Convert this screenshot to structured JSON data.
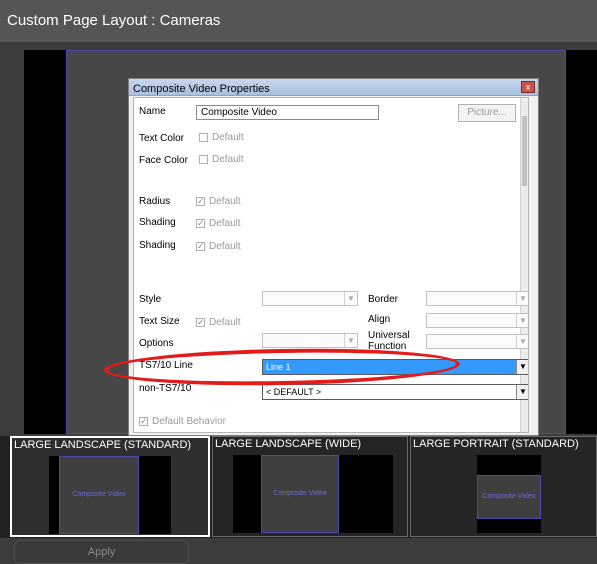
{
  "window": {
    "title": "Custom Page Layout : Cameras"
  },
  "dialog": {
    "title": "Composite Video Properties",
    "close_glyph": "x",
    "name_label": "Name",
    "name_value": "Composite Video",
    "picture_button": "Picture...",
    "text_color_label": "Text Color",
    "face_color_label": "Face Color",
    "radius_label": "Radius",
    "shading_label": "Shading",
    "shading2_label": "Shading",
    "default_label": "Default",
    "style_label": "Style",
    "border_label": "Border",
    "text_size_label": "Text Size",
    "align_label": "Align",
    "options_label": "Options",
    "universal_function_label": "Universal Function",
    "ts710_label": "TS7/10 Line",
    "ts710_value": "Line 1",
    "non_ts710_label": "non-TS7/10",
    "non_ts710_value": "< DEFAULT >",
    "default_behavior_label": "Default Behavior",
    "checkmark": "✓",
    "dropdown_arrow": "▼"
  },
  "layout_tabs": [
    {
      "label": "LARGE LANDSCAPE (STANDARD)",
      "preview_text": "Composite Video"
    },
    {
      "label": "LARGE LANDSCAPE (WIDE)",
      "preview_text": "Composite Video"
    },
    {
      "label": "LARGE PORTRAIT (STANDARD)",
      "preview_text": "Composite Video"
    }
  ],
  "footer": {
    "apply_button": "Apply"
  },
  "colors": {
    "selection": "#3399ff",
    "annotation": "#e31b1b",
    "preview_border": "#4a4aa8"
  }
}
